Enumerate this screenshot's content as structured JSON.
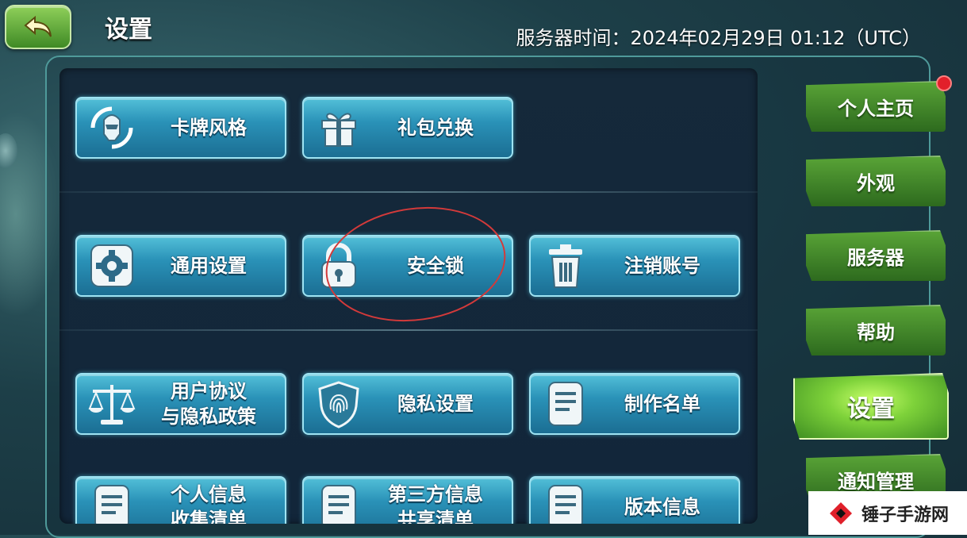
{
  "header": {
    "title": "设置",
    "server_time": "服务器时间：2024年02月29日 01:12（UTC）"
  },
  "grid": {
    "card_style": "卡牌风格",
    "gift_redeem": "礼包兑换",
    "general_settings": "通用设置",
    "security_lock": "安全锁",
    "delete_account": "注销账号",
    "user_agreement_line1": "用户协议",
    "user_agreement_line2": "与隐私政策",
    "privacy_settings": "隐私设置",
    "credits": "制作名单",
    "personal_info_line1": "个人信息",
    "personal_info_line2": "收集清单",
    "third_party_line1": "第三方信息",
    "third_party_line2": "共享清单",
    "version_info": "版本信息"
  },
  "tabs": [
    {
      "label": "个人主页",
      "has_badge": true
    },
    {
      "label": "外观"
    },
    {
      "label": "服务器"
    },
    {
      "label": "帮助"
    },
    {
      "label": "设置",
      "active": true
    },
    {
      "label": "通知管理"
    }
  ],
  "watermark": "锤子手游网",
  "colors": {
    "button_blue": "#2a92b8",
    "tab_green": "#5aa537",
    "badge_red": "#e2202a",
    "annotation_red": "#d33a3a"
  }
}
